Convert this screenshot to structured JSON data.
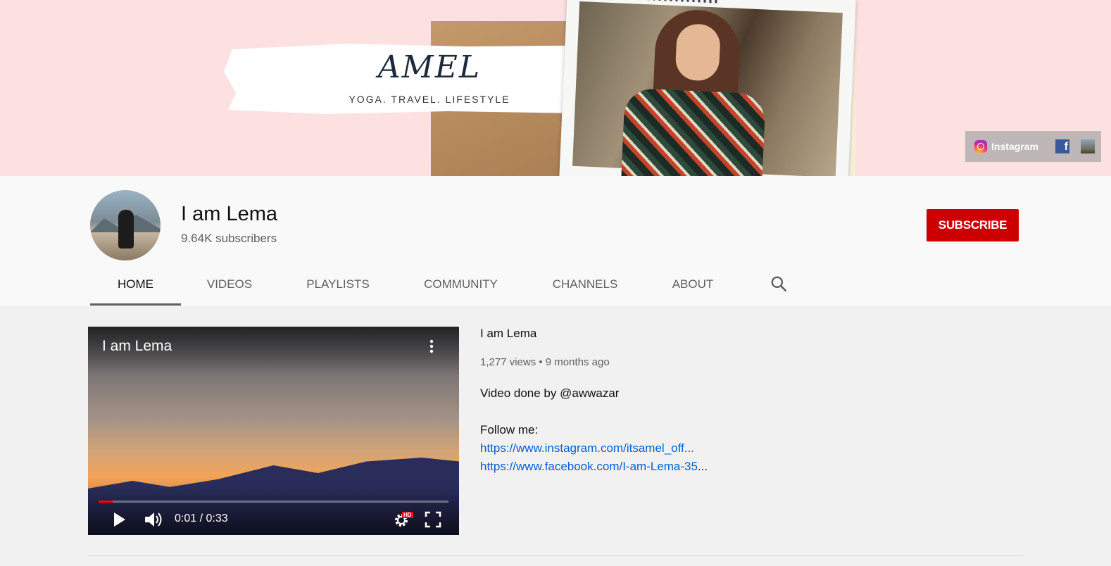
{
  "banner": {
    "logo_text": "AMEL",
    "tagline": "YOGA.  TRAVEL.  LIFESTYLE",
    "social": {
      "instagram_label": "Instagram",
      "facebook_glyph": "f"
    }
  },
  "channel": {
    "name": "I am Lema",
    "subscribers": "9.64K subscribers",
    "subscribe_label": "SUBSCRIBE"
  },
  "tabs": [
    {
      "label": "HOME",
      "active": true
    },
    {
      "label": "VIDEOS"
    },
    {
      "label": "PLAYLISTS"
    },
    {
      "label": "COMMUNITY"
    },
    {
      "label": "CHANNELS"
    },
    {
      "label": "ABOUT"
    }
  ],
  "featured_video": {
    "player_title": "I am Lema",
    "time": "0:01 / 0:33",
    "progress": 0.04,
    "hd_badge": "HD",
    "title": "I am Lema",
    "meta": "1,277 views • 9 months ago",
    "description_line1": "Video done by @awwazar",
    "description_line2": "Follow me:",
    "link_instagram": "https://www.instagram.com/itsamel_off...",
    "link_facebook": "https://www.facebook.com/I-am-Lema-35",
    "link_facebook_ellipsis": "..."
  },
  "colors": {
    "subscribe_red": "#cc0000",
    "link_blue": "#065fd4",
    "banner_pink": "#fde0e0",
    "progress_red": "#ff0000"
  },
  "icons": {
    "search": "search-icon",
    "play": "play-icon",
    "volume": "volume-icon",
    "settings": "settings-icon",
    "fullscreen": "fullscreen-icon",
    "more": "more-vert-icon"
  }
}
